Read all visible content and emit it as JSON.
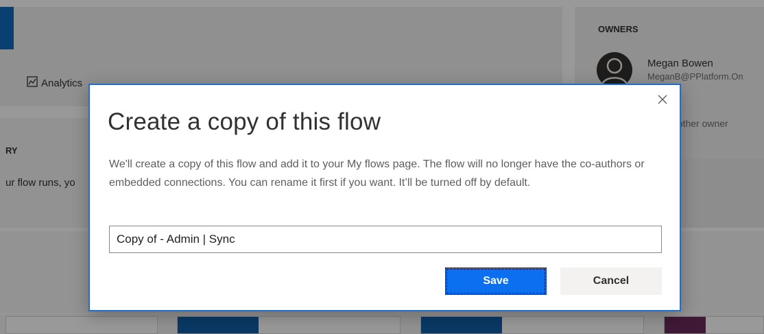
{
  "background": {
    "analytics_link": "Analytics",
    "owners": {
      "label": "OWNERS",
      "name": "Megan Bowen",
      "email": "MeganB@PPlatform.On",
      "add_owner_text": "nother owner"
    },
    "history": {
      "label": "RY",
      "text": "ur flow runs, yo"
    }
  },
  "dialog": {
    "title": "Create a copy of this flow",
    "description": "We'll create a copy of this flow and add it to your My flows page. The flow will no longer have the co-authors or embedded connections. You can rename it first if you want. It’ll be turned off by default.",
    "name_value": "Copy of - Admin | Sync",
    "save_label": "Save",
    "cancel_label": "Cancel",
    "close_icon": "close-icon"
  },
  "colors": {
    "accent": "#0f6cbd",
    "dialog_border": "#1f6fcf",
    "save_bg": "#0b6ff0",
    "cancel_bg": "#f3f2f1"
  }
}
